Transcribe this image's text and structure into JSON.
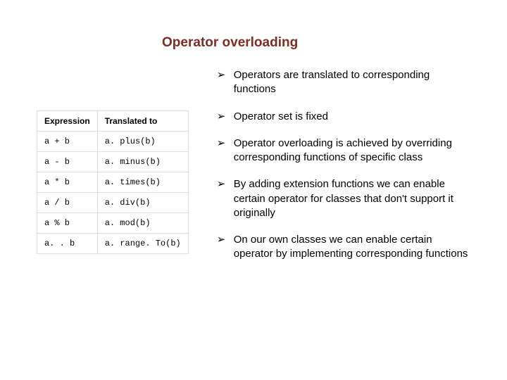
{
  "title": "Operator overloading",
  "table": {
    "headers": {
      "col1": "Expression",
      "col2": "Translated to"
    },
    "rows": [
      {
        "expr": "a + b",
        "trans": "a. plus(b)"
      },
      {
        "expr": "a - b",
        "trans": "a. minus(b)"
      },
      {
        "expr": "a * b",
        "trans": "a. times(b)"
      },
      {
        "expr": "a / b",
        "trans": "a. div(b)"
      },
      {
        "expr": "a % b",
        "trans": "a. mod(b)"
      },
      {
        "expr": "a. . b",
        "trans": "a. range. To(b)"
      }
    ]
  },
  "bullets": [
    "Operators are translated to corresponding functions",
    "Operator set is fixed",
    "Operator  overloading is achieved by overriding corresponding functions of specific class",
    "By adding extension functions we can enable certain operator for classes that don't support it originally",
    "On our own classes we can enable certain operator by implementing corresponding  functions"
  ]
}
